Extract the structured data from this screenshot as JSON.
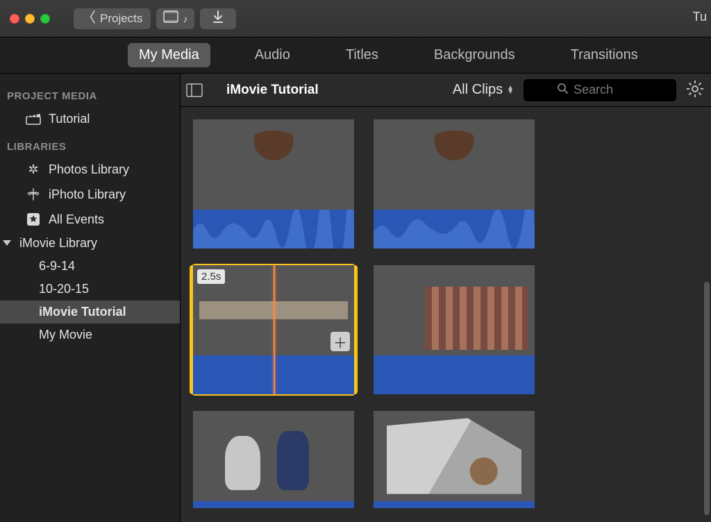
{
  "titlebar": {
    "back_label": "Projects",
    "title_fragment": "Tu"
  },
  "tabs": {
    "my_media": "My Media",
    "audio": "Audio",
    "titles": "Titles",
    "backgrounds": "Backgrounds",
    "transitions": "Transitions"
  },
  "sidebar": {
    "project_media_header": "PROJECT MEDIA",
    "project_media_item": "Tutorial",
    "libraries_header": "LIBRARIES",
    "photos_library": "Photos Library",
    "iphoto_library": "iPhoto Library",
    "all_events": "All Events",
    "imovie_library": "iMovie Library",
    "events": {
      "e1": "6-9-14",
      "e2": "10-20-15",
      "e3": "iMovie Tutorial",
      "e4": "My Movie"
    }
  },
  "browser": {
    "title": "iMovie Tutorial",
    "filter": "All Clips",
    "search_placeholder": "Search"
  },
  "clips": {
    "selected_duration": "2.5s"
  }
}
